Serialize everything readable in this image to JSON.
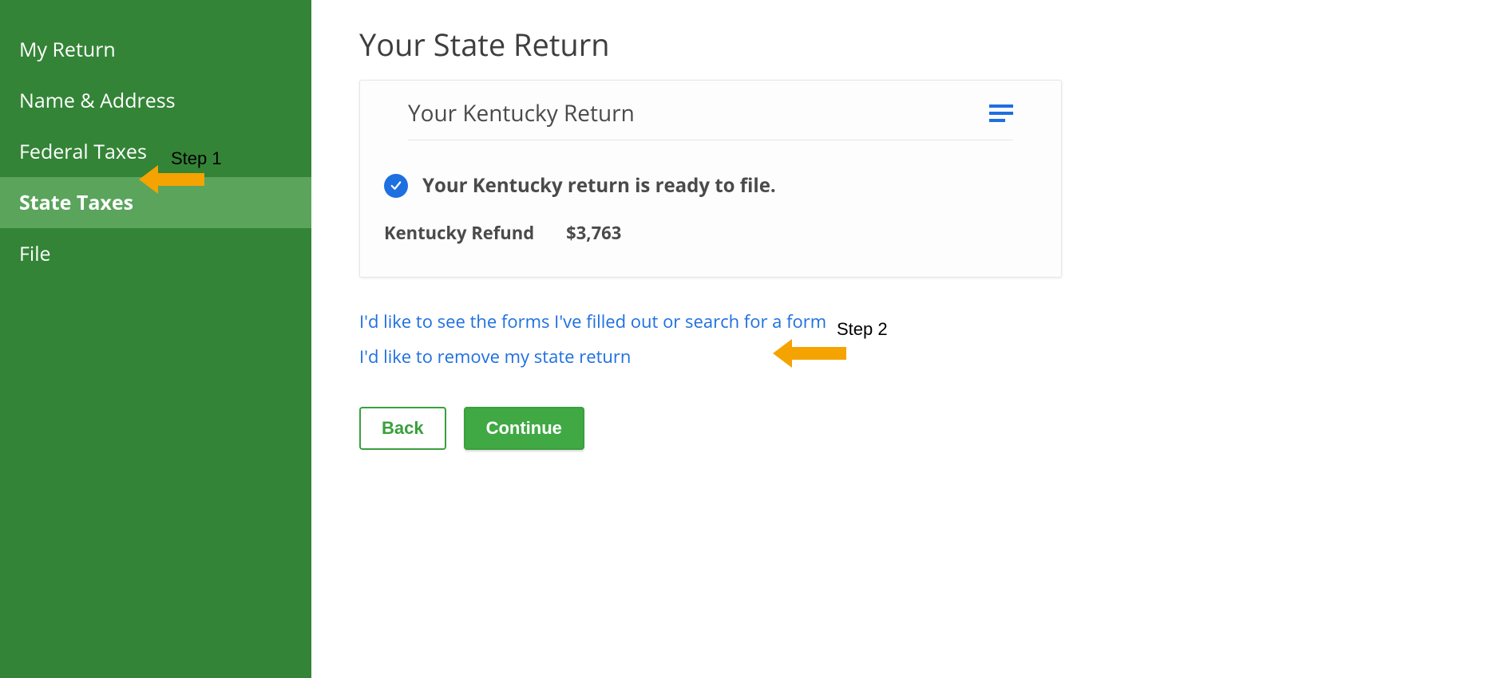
{
  "sidebar": {
    "items": [
      {
        "label": "My Return"
      },
      {
        "label": "Name & Address"
      },
      {
        "label": "Federal Taxes"
      },
      {
        "label": "State Taxes"
      },
      {
        "label": "File"
      }
    ],
    "activeIndex": 3
  },
  "main": {
    "title": "Your State Return",
    "card": {
      "title": "Your Kentucky Return",
      "status_text": "Your Kentucky return is ready to file.",
      "refund_label": "Kentucky Refund",
      "refund_amount": "$3,763"
    },
    "links": {
      "see_forms": "I'd like to see the forms I've filled out or search for a form",
      "remove_state": "I'd like to remove my state return"
    },
    "buttons": {
      "back": "Back",
      "continue": "Continue"
    }
  },
  "annotations": {
    "step1": "Step 1",
    "step2": "Step 2"
  }
}
